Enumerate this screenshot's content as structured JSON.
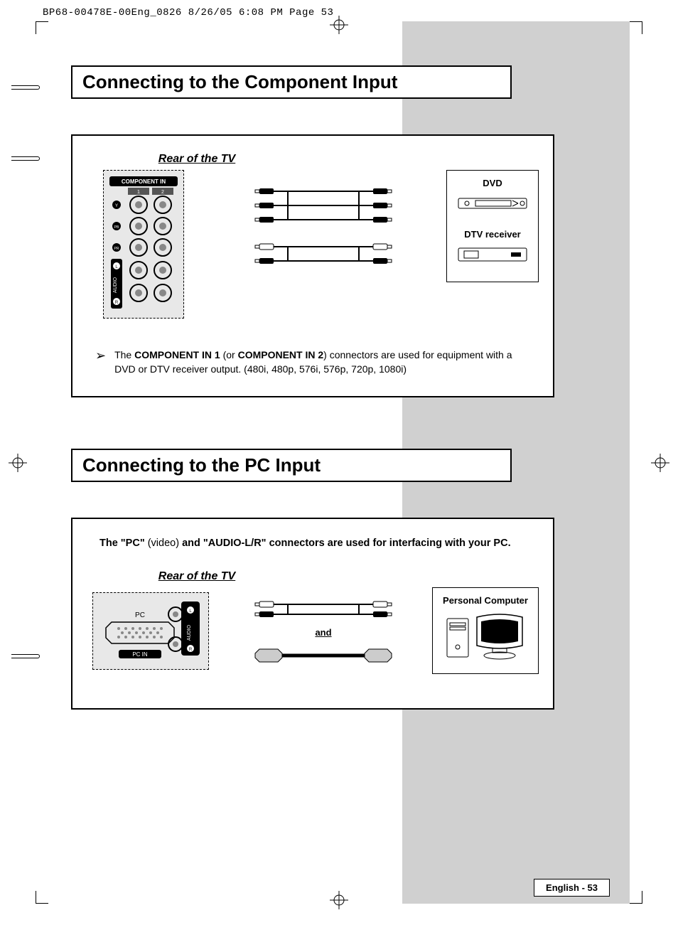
{
  "slug": "BP68-00478E-00Eng_0826  8/26/05  6:08 PM  Page 53",
  "headings": {
    "component": "Connecting to the Component Input",
    "pc": "Connecting to the PC Input"
  },
  "labels": {
    "rear_of_tv": "Rear of the TV",
    "and": "and",
    "component_in_header": "COMPONENT IN",
    "pc_in_header": "PC IN",
    "pc_port_label": "PC",
    "audio_label": "AUDIO",
    "col1": "1",
    "col2": "2",
    "port_y": "Y",
    "port_pb": "PB",
    "port_pr": "PR",
    "port_l": "L",
    "port_r": "R"
  },
  "devices": {
    "dvd": "DVD",
    "dtv": "DTV receiver",
    "pc": "Personal Computer"
  },
  "note": {
    "p1a": "The ",
    "p1b": "COMPONENT IN 1",
    "p1c": " (or ",
    "p1d": "COMPONENT IN 2",
    "p1e": ") connectors are used for equipment with a DVD or DTV receiver output. (480i, 480p, 576i, 576p, 720p, 1080i)"
  },
  "pc_note": {
    "a": "The \"PC\"",
    "b": " (video) ",
    "c": "and \"AUDIO-L/R\" connectors are used for interfacing with your PC."
  },
  "footer": "English - 53"
}
